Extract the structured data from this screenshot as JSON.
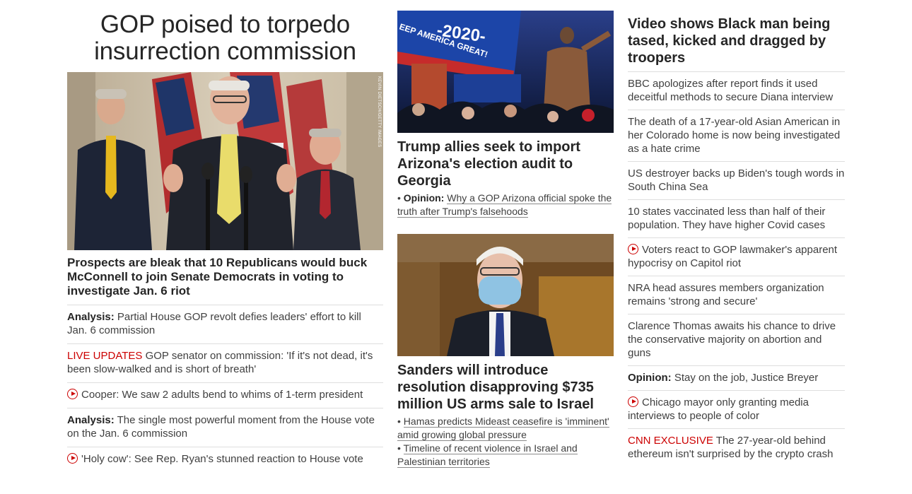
{
  "left": {
    "headline": "GOP poised to torpedo insurrection commission",
    "photo_credit": "KEVIN DIETSCH/GETTY IMAGES",
    "lead": "Prospects are bleak that 10 Republicans would buck McConnell to join Senate Democrats in voting to investigate Jan. 6 riot",
    "items": [
      {
        "tag": "Analysis:",
        "text": "Partial House GOP revolt defies leaders' effort to kill Jan. 6 commission"
      },
      {
        "tag": "LIVE UPDATES",
        "text": "GOP senator on commission: 'If it's not dead, it's been slow-walked and is short of breath'"
      },
      {
        "text": "Cooper: We saw 2 adults bend to whims of 1-term president",
        "icon": "play-icon"
      },
      {
        "tag": "Analysis:",
        "text": "The single most powerful moment from the House vote on the Jan. 6 commission"
      },
      {
        "text": "'Holy cow': See Rep. Ryan's stunned reaction to House vote",
        "icon": "play-icon"
      }
    ]
  },
  "middle": {
    "story1": {
      "headline": "Trump allies seek to import Arizona's election audit to Georgia",
      "bullet": "•",
      "sub_tag": "Opinion:",
      "sub_text": "Why a GOP Arizona official spoke the truth after Trump's falsehoods",
      "photo_text": "-2020-",
      "photo_text2": "EEP AMERICA GREAT!"
    },
    "story2": {
      "headline": "Sanders will introduce resolution disapproving $735 million US arms sale to Israel",
      "bullets": [
        "Hamas predicts Mideast ceasefire is 'imminent' amid growing global pressure",
        "Timeline of recent violence in Israel and Palestinian territories"
      ]
    }
  },
  "right": {
    "headline": "Video shows Black man being tased, kicked and dragged by troopers",
    "items": [
      {
        "text": "BBC apologizes after report finds it used deceitful methods to secure Diana interview"
      },
      {
        "text": "The death of a 17-year-old Asian American in her Colorado home is now being investigated as a hate crime"
      },
      {
        "text": "US destroyer backs up Biden's tough words in South China Sea"
      },
      {
        "text": "10 states vaccinated less than half of their population. They have higher Covid cases"
      },
      {
        "text": "Voters react to GOP lawmaker's apparent hypocrisy on Capitol riot",
        "icon": "play-icon"
      },
      {
        "text": "NRA head assures members organization remains 'strong and secure'"
      },
      {
        "text": "Clarence Thomas awaits his chance to drive the conservative majority on abortion and guns"
      },
      {
        "tag": "Opinion:",
        "text": "Stay on the job, Justice Breyer"
      },
      {
        "text": "Chicago mayor only granting media interviews to people of color",
        "icon": "play-icon"
      },
      {
        "tag": "CNN EXCLUSIVE",
        "text": "The 27-year-old behind ethereum isn't surprised by the crypto crash"
      }
    ]
  },
  "colors": {
    "accent_red": "#cc0000",
    "text": "#262626",
    "muted": "#404040",
    "divider": "#dedede"
  }
}
